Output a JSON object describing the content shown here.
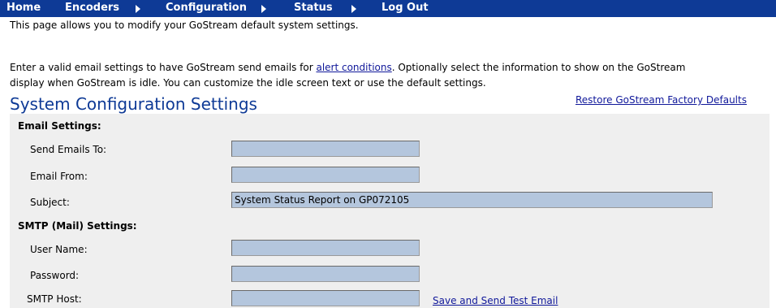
{
  "nav": {
    "home": "Home",
    "encoders": "Encoders",
    "configuration": "Configuration",
    "status": "Status",
    "logout": "Log Out"
  },
  "intro": {
    "line1": "This page allows you to modify your GoStream default system settings.",
    "line2_prefix": "Enter a valid email settings to have GoStream send emails for ",
    "line2_link": "alert conditions",
    "line2_suffix": ". Optionally select the information to show on the GoStream",
    "line3": "display when GoStream is idle. You can customize the idle screen text or use the default settings."
  },
  "page_title": "System Configuration Settings",
  "restore_link": "Restore GoStream Factory Defaults",
  "email_section": {
    "heading": "Email Settings:",
    "send_to_label": "Send Emails To:",
    "send_to_value": "",
    "from_label": "Email From:",
    "from_value": "",
    "subject_label": "Subject:",
    "subject_value": "System Status Report on GP072105"
  },
  "smtp_section": {
    "heading": "SMTP (Mail) Settings:",
    "username_label": "User Name:",
    "username_value": "",
    "password_label": "Password:",
    "password_value": "",
    "host_label": "SMTP Host:",
    "host_value": "",
    "test_link": "Save and Send Test Email"
  }
}
